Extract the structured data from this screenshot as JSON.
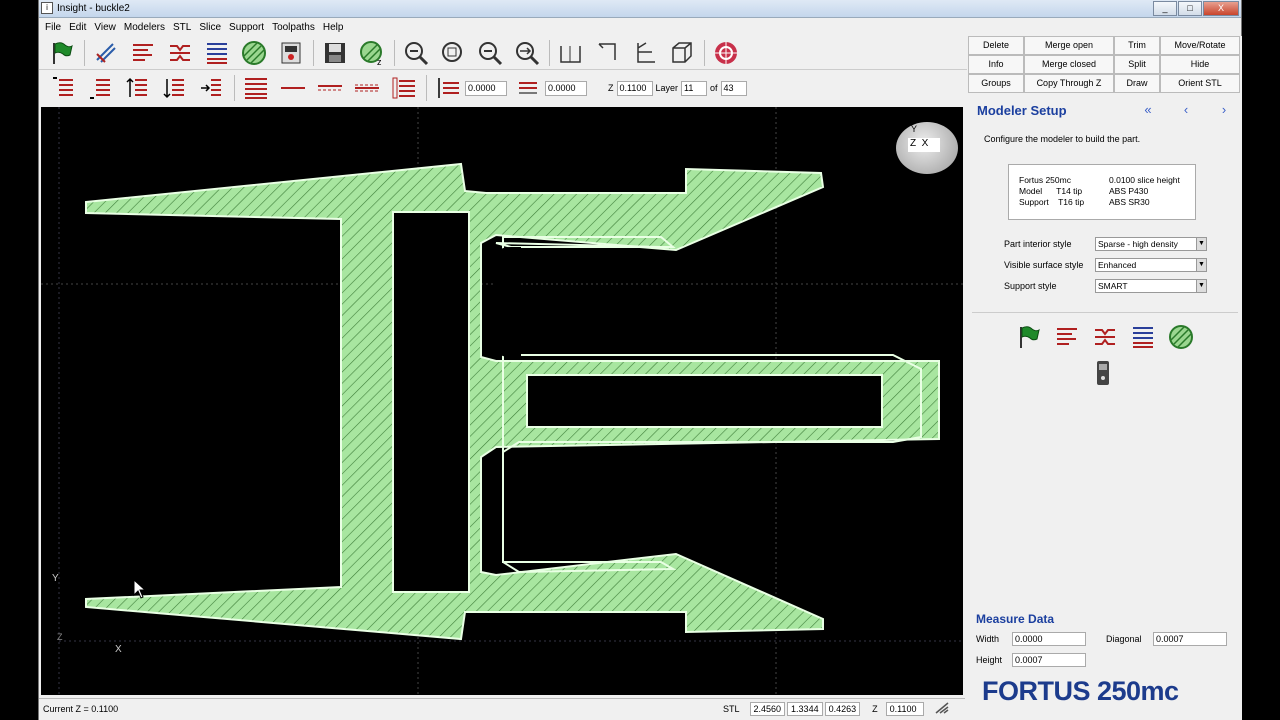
{
  "window": {
    "title": "Insight - buckle2",
    "app_icon": "i",
    "min": "_",
    "max": "□",
    "close": "X"
  },
  "menu": [
    "File",
    "Edit",
    "View",
    "Modelers",
    "STL",
    "Slice",
    "Support",
    "Toolpaths",
    "Help"
  ],
  "toolbar2": {
    "value1": "0.0000",
    "value2": "0.0000",
    "z_label": "Z",
    "z_value": "0.1100",
    "layer_label": "Layer",
    "layer_value": "11",
    "of_label": "of",
    "of_value": "43"
  },
  "commands": [
    [
      "Delete",
      "Merge open",
      "Trim",
      "Move/Rotate"
    ],
    [
      "Info",
      "Merge closed",
      "Split",
      "Hide"
    ],
    [
      "Groups",
      "Copy Through Z",
      "Draw",
      "Orient STL"
    ]
  ],
  "modeler_setup": {
    "title": "Modeler Setup",
    "nav_first": "«",
    "nav_prev": "‹",
    "nav_next": "›",
    "description": "Configure the modeler to build the part.",
    "info": {
      "left": [
        "Fortus 250mc",
        "Model      T14 tip",
        "Support    T16 tip"
      ],
      "right": [
        "0.0100 slice height",
        "ABS P430",
        "ABS SR30"
      ]
    },
    "part_interior_label": "Part interior style",
    "part_interior_value": "Sparse - high density",
    "visible_surface_label": "Visible surface style",
    "visible_surface_value": "Enhanced",
    "support_style_label": "Support style",
    "support_style_value": "SMART"
  },
  "viewport": {
    "axis_y": "Y",
    "axis_x": "X",
    "axis_z": "Z",
    "orient_y": "Y",
    "orient_zx": "Z  X"
  },
  "measure": {
    "title": "Measure Data",
    "width_label": "Width",
    "width_value": "0.0000",
    "height_label": "Height",
    "height_value": "0.0007",
    "diagonal_label": "Diagonal",
    "diagonal_value": "0.0007"
  },
  "status": {
    "current_z": "Current Z = 0.1100",
    "stl_label": "STL",
    "stl_x": "2.4560",
    "stl_y": "1.3344",
    "stl_z": "0.4263",
    "z_label": "Z",
    "z_value": "0.1100"
  },
  "brand": "FORTUS 250mc",
  "colors": {
    "part_fill": "#a8e6a0",
    "accent_blue": "#1b3f9f",
    "viewport_bg": "#000000"
  }
}
